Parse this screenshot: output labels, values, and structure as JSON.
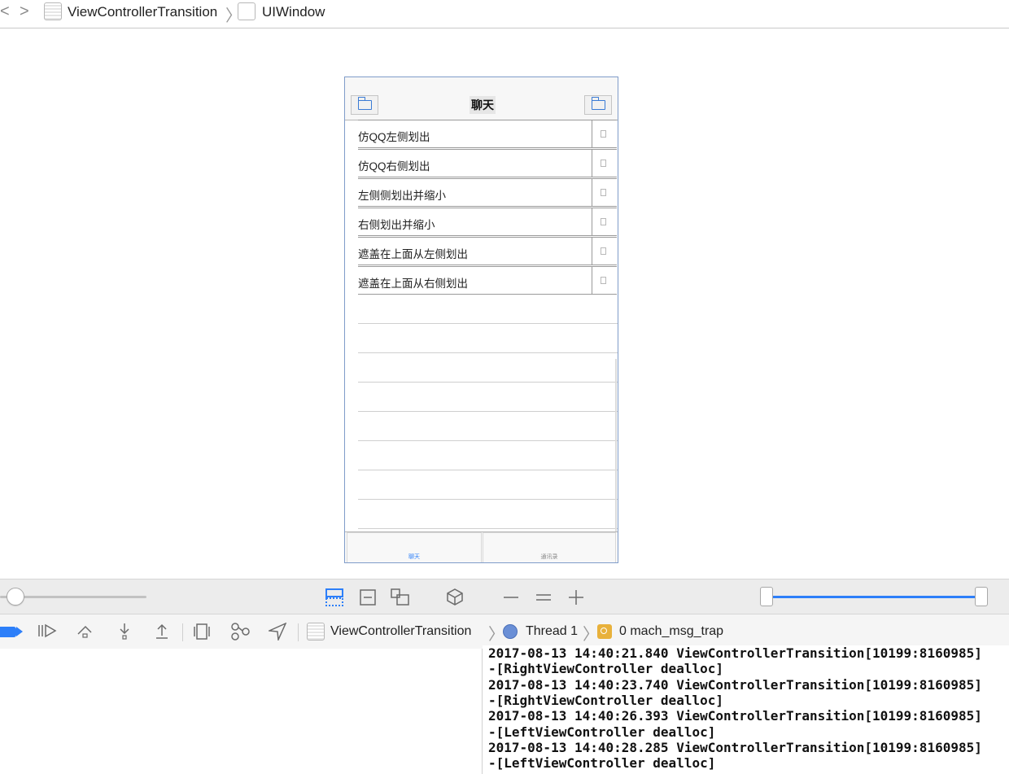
{
  "breadcrumb": {
    "back_label": "<",
    "forward_label": ">",
    "items": [
      {
        "label": "ViewControllerTransition",
        "icon": "project-file-icon"
      },
      {
        "label": "UIWindow",
        "icon": "window-icon"
      }
    ]
  },
  "simulator": {
    "nav_title": "聊天",
    "left_button_icon": "folder-icon",
    "right_button_icon": "folder-icon",
    "rows": [
      {
        "label": "仿QQ左侧划出"
      },
      {
        "label": "仿QQ右侧划出"
      },
      {
        "label": "左侧侧划出并缩小"
      },
      {
        "label": "右侧划出并缩小"
      },
      {
        "label": "遮盖在上面从左侧划出"
      },
      {
        "label": "遮盖在上面从右侧划出"
      }
    ],
    "tabs": [
      {
        "label": "聊天",
        "selected": true
      },
      {
        "label": "通讯录",
        "selected": false
      }
    ]
  },
  "debug_toolbar": {
    "breadcrumb": [
      {
        "label": "ViewControllerTransition",
        "icon": "project-file-icon"
      },
      {
        "label": "Thread 1",
        "icon": "thread-icon"
      },
      {
        "label": "0 mach_msg_trap",
        "icon": "stack-frame-icon"
      }
    ]
  },
  "console": {
    "lines": [
      "2017-08-13 14:40:21.840 ViewControllerTransition[10199:8160985]",
      "-[RightViewController dealloc]",
      "2017-08-13 14:40:23.740 ViewControllerTransition[10199:8160985]",
      "-[RightViewController dealloc]",
      "2017-08-13 14:40:26.393 ViewControllerTransition[10199:8160985]",
      "-[LeftViewController dealloc]",
      "2017-08-13 14:40:28.285 ViewControllerTransition[10199:8160985]",
      "-[LeftViewController dealloc]"
    ]
  },
  "colors": {
    "accent": "#2d7ff9",
    "device_border": "#7f9cc9"
  }
}
